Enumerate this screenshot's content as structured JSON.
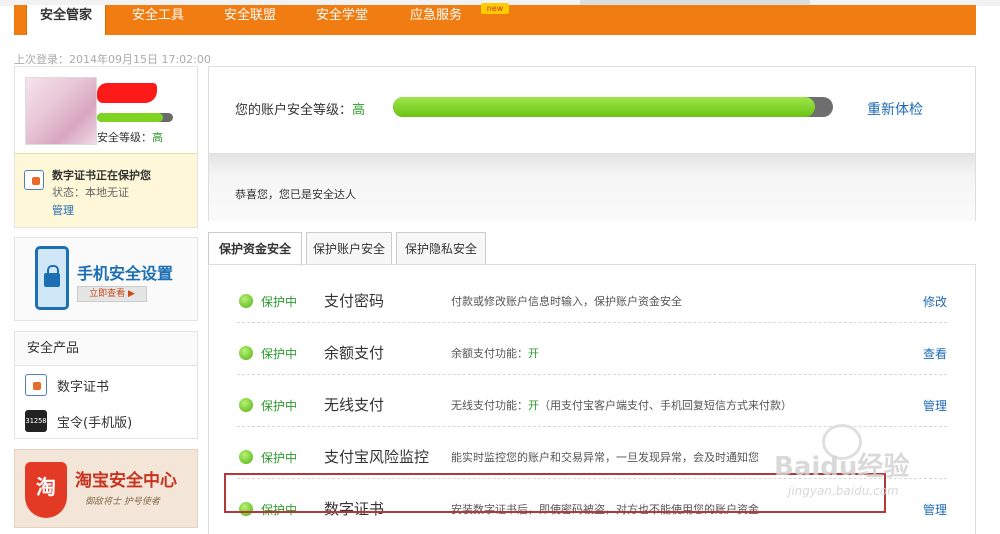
{
  "nav": {
    "tabs": [
      "安全管家",
      "安全工具",
      "安全联盟",
      "安全学堂",
      "应急服务"
    ],
    "badge": "new"
  },
  "last_login": "上次登录：2014年09月15日 17:02:00",
  "profile": {
    "security_level_label": "安全等级：",
    "security_level_value": "高",
    "security_level_fraction": 0.87,
    "cert_title": "数字证书正在保护您",
    "cert_state": "状态：本地无证",
    "cert_manage": "管理"
  },
  "phone_banner": {
    "title": "手机安全设置",
    "button": "立即查看 ▶"
  },
  "products": {
    "header": "安全产品",
    "items": [
      {
        "label": "数字证书",
        "icon": "digital-certificate-icon"
      },
      {
        "label": "宝令(手机版)",
        "icon": "token-icon",
        "icon_text": "31258"
      }
    ]
  },
  "taobao": {
    "shield_char": "淘",
    "title": "淘宝安全中心",
    "subtitle": "御敌将士  护号使者"
  },
  "account_level": {
    "label": "您的账户安全等级：",
    "value": "高",
    "fraction": 0.96,
    "recheck": "重新体检",
    "congrats": "恭喜您，您已是安全达人"
  },
  "tabs": [
    "保护资金安全",
    "保护账户安全",
    "保护隐私安全"
  ],
  "rows": [
    {
      "status": "保护中",
      "name": "支付密码",
      "desc": "付款或修改账户信息时输入，保护账户资金安全",
      "desc_hi": "",
      "desc_tail": "",
      "action": "修改"
    },
    {
      "status": "保护中",
      "name": "余额支付",
      "desc": "余额支付功能：",
      "desc_hi": "开",
      "desc_tail": "",
      "action": "查看"
    },
    {
      "status": "保护中",
      "name": "无线支付",
      "desc": "无线支付功能：",
      "desc_hi": "开",
      "desc_tail": "（用支付宝客户端支付、手机回复短信方式来付款）",
      "action": "管理"
    },
    {
      "status": "保护中",
      "name": "支付宝风险监控",
      "desc": "能实时监控您的账户和交易异常，一旦发现异常，会及时通知您",
      "desc_hi": "",
      "desc_tail": "",
      "action": ""
    },
    {
      "status": "保护中",
      "name": "数字证书",
      "desc": "安装数字证书后，即使密码被盗，对方也不能使用您的账户资金",
      "desc_hi": "",
      "desc_tail": "",
      "action": "管理"
    }
  ],
  "watermark": {
    "title": "Baidu经验",
    "url": "jingyan.baidu.com"
  },
  "colors": {
    "nav_orange": "#f07c12",
    "link_blue": "#1f6bb5",
    "status_green": "#2c9a2c",
    "bar_green": "#7fd421"
  }
}
